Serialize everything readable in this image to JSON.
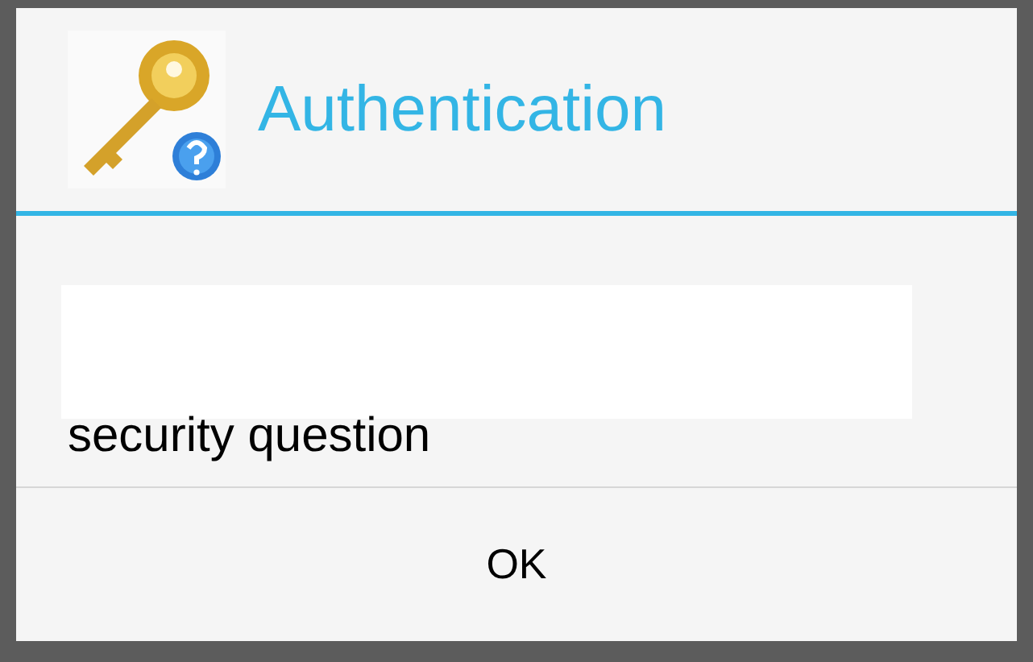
{
  "dialog": {
    "title": "Authentication",
    "message_tail": "security question",
    "buttons": [
      "OK"
    ]
  }
}
